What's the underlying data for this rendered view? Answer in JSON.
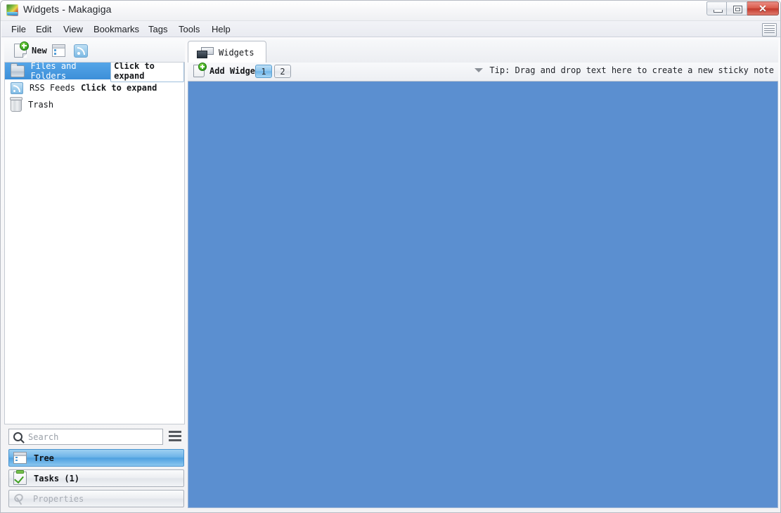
{
  "window": {
    "title": "Widgets - Makagiga",
    "app_icon": "makagiga-icon",
    "controls": {
      "minimize": "minimize-button",
      "maximize": "maximize-button",
      "close_glyph": "✕"
    }
  },
  "menubar": {
    "items": [
      {
        "label": "File"
      },
      {
        "label": "Edit"
      },
      {
        "label": "View"
      },
      {
        "label": "Bookmarks"
      },
      {
        "label": "Tags"
      },
      {
        "label": "Tools"
      },
      {
        "label": "Help"
      }
    ],
    "right_icon": "calendar-icon"
  },
  "sidebar": {
    "toolbar": {
      "new_label": "New",
      "new_icon": "new-page-icon",
      "tree_icon": "tree-view-icon",
      "rss_icon": "rss-feed-icon"
    },
    "tree_items": [
      {
        "label": "Files and Folders",
        "hint": "Click to expand",
        "icon": "folder-icon",
        "selected": true
      },
      {
        "label": "RSS Feeds",
        "hint": "Click to expand",
        "icon": "rss-icon",
        "selected": false
      },
      {
        "label": "Trash",
        "hint": "",
        "icon": "trash-icon",
        "selected": false
      }
    ],
    "search": {
      "placeholder": "Search",
      "value": "",
      "icon": "search-icon",
      "menu_icon": "hamburger-menu-icon"
    },
    "sections": [
      {
        "label": "Tree",
        "icon": "tree-icon",
        "state": "active"
      },
      {
        "label": "Tasks (1)",
        "icon": "tasks-icon",
        "state": "normal"
      },
      {
        "label": "Properties",
        "icon": "properties-icon",
        "state": "disabled"
      }
    ]
  },
  "main": {
    "tabs": [
      {
        "label": "Widgets",
        "icon": "widgets-icon",
        "active": true
      }
    ],
    "toolbar": {
      "add_widget_label": "Add Widget",
      "add_widget_icon": "add-widget-icon",
      "pages": [
        {
          "label": "1",
          "active": true
        },
        {
          "label": "2",
          "active": false
        }
      ],
      "tip_text": "Tip: Drag and drop text here to create a new sticky note",
      "tip_caret_icon": "caret-down-icon"
    },
    "canvas": {
      "background_color": "#5b8fd0"
    }
  },
  "colors": {
    "accent_blue": "#3d8fd8",
    "canvas_blue": "#5b8fd0",
    "titlebar": "#f7f7f9",
    "close_red": "#c2392c"
  }
}
